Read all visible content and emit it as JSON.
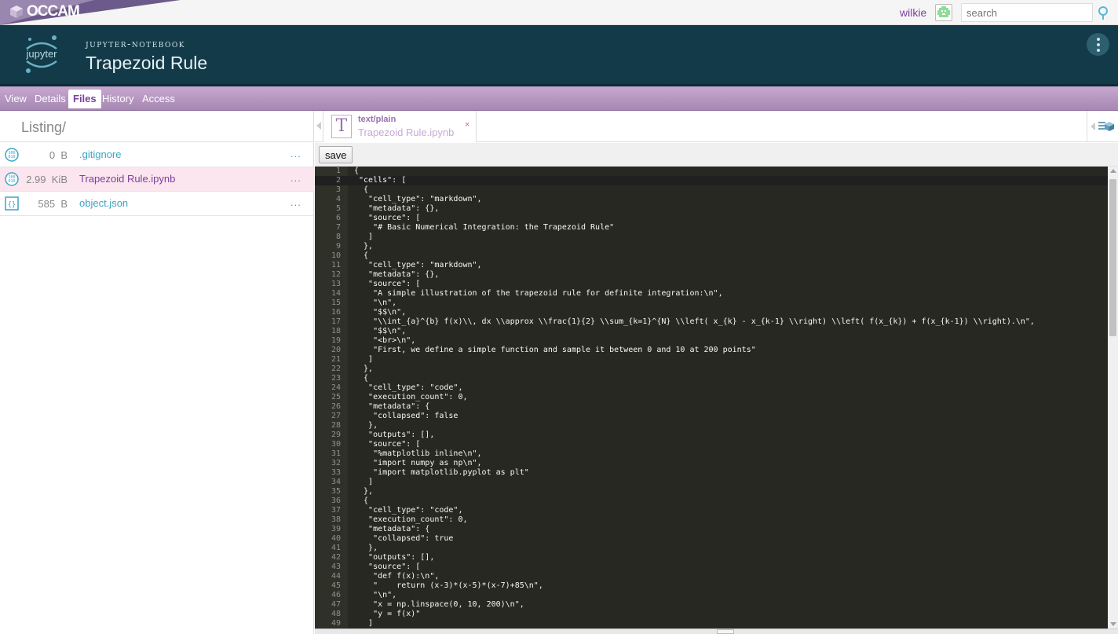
{
  "topbar": {
    "logo_text": "OCCAM",
    "username": "wilkie",
    "search_placeholder": "search"
  },
  "header": {
    "object_type": "jupyter-notebook",
    "title": "Trapezoid Rule",
    "logo_text": "jupyter"
  },
  "tabs": [
    {
      "label": "View"
    },
    {
      "label": "Details"
    },
    {
      "label": "Files"
    },
    {
      "label": "History"
    },
    {
      "label": "Access"
    }
  ],
  "active_tab": "Files",
  "listing": {
    "title": "Listing/",
    "files": [
      {
        "size": "0",
        "unit": "B",
        "name": ".gitignore",
        "more": "...",
        "icon": "binary-file-icon"
      },
      {
        "size": "2.99",
        "unit": "KiB",
        "name": "Trapezoid Rule.ipynb",
        "more": "...",
        "icon": "binary-file-icon"
      },
      {
        "size": "585",
        "unit": "B",
        "name": "object.json",
        "more": "...",
        "icon": "json-file-icon"
      }
    ]
  },
  "file_tab": {
    "mime": "text/plain",
    "name": "Trapezoid Rule.ipynb",
    "close": "×",
    "icon_letter": "T"
  },
  "editor": {
    "save_label": "save",
    "lines": [
      "{",
      " \"cells\": [",
      "  {",
      "   \"cell_type\": \"markdown\",",
      "   \"metadata\": {},",
      "   \"source\": [",
      "    \"# Basic Numerical Integration: the Trapezoid Rule\"",
      "   ]",
      "  },",
      "  {",
      "   \"cell_type\": \"markdown\",",
      "   \"metadata\": {},",
      "   \"source\": [",
      "    \"A simple illustration of the trapezoid rule for definite integration:\\n\",",
      "    \"\\n\",",
      "    \"$$\\n\",",
      "    \"\\\\int_{a}^{b} f(x)\\\\, dx \\\\approx \\\\frac{1}{2} \\\\sum_{k=1}^{N} \\\\left( x_{k} - x_{k-1} \\\\right) \\\\left( f(x_{k}) + f(x_{k-1}) \\\\right).\\n\",",
      "    \"$$\\n\",",
      "    \"<br>\\n\",",
      "    \"First, we define a simple function and sample it between 0 and 10 at 200 points\"",
      "   ]",
      "  },",
      "  {",
      "   \"cell_type\": \"code\",",
      "   \"execution_count\": 0,",
      "   \"metadata\": {",
      "    \"collapsed\": false",
      "   },",
      "   \"outputs\": [],",
      "   \"source\": [",
      "    \"%matplotlib inline\\n\",",
      "    \"import numpy as np\\n\",",
      "    \"import matplotlib.pyplot as plt\"",
      "   ]",
      "  },",
      "  {",
      "   \"cell_type\": \"code\",",
      "   \"execution_count\": 0,",
      "   \"metadata\": {",
      "    \"collapsed\": true",
      "   },",
      "   \"outputs\": [],",
      "   \"source\": [",
      "    \"def f(x):\\n\",",
      "    \"    return (x-3)*(x-5)*(x-7)+85\\n\",",
      "    \"\\n\",",
      "    \"x = np.linspace(0, 10, 200)\\n\",",
      "    \"y = f(x)\"",
      "   ]"
    ]
  },
  "colors": {
    "accent": "#7c3f9f",
    "link": "#3ba4c4",
    "header_bg": "#123a48",
    "editor_bg": "#272822"
  }
}
